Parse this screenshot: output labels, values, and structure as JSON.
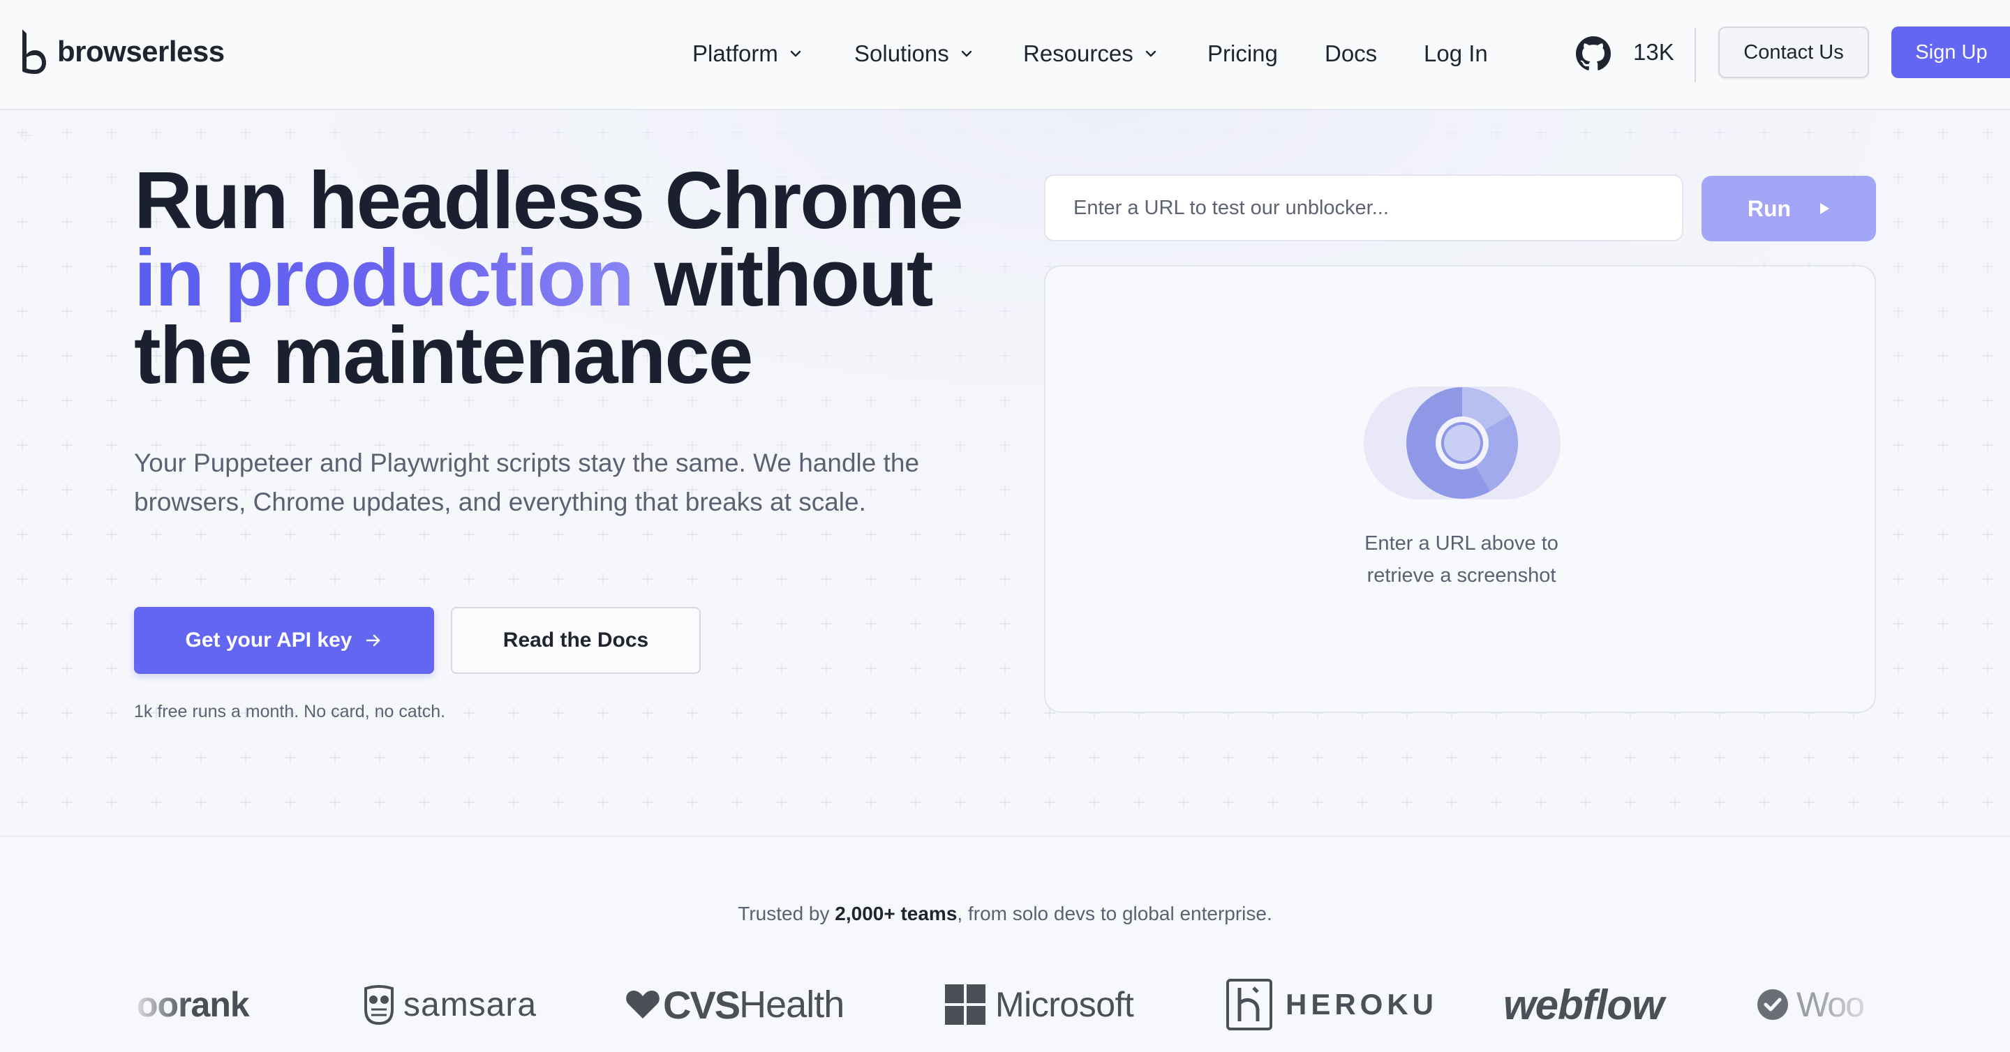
{
  "header": {
    "brand": "browserless",
    "nav": [
      {
        "label": "Platform",
        "has_dropdown": true
      },
      {
        "label": "Solutions",
        "has_dropdown": true
      },
      {
        "label": "Resources",
        "has_dropdown": true
      },
      {
        "label": "Pricing",
        "has_dropdown": false
      },
      {
        "label": "Docs",
        "has_dropdown": false
      },
      {
        "label": "Log In",
        "has_dropdown": false
      }
    ],
    "github_icon": "github-icon",
    "github_stars": "13K",
    "contact_label": "Contact Us",
    "signup_label": "Sign Up"
  },
  "hero": {
    "title_line1": "Run headless Chrome",
    "title_accent": "in production",
    "title_line2_rest": " without",
    "title_line3": "the maintenance",
    "subtitle": "Your Puppeteer and Playwright scripts stay the same. We handle the browsers, Chrome updates, and everything that breaks at scale.",
    "cta_primary": "Get your API key",
    "cta_secondary": "Read the Docs",
    "note": "1k free runs a month. No card, no catch."
  },
  "tester": {
    "url_placeholder": "Enter a URL to test our unblocker...",
    "url_value": "",
    "run_label": "Run",
    "empty_line1": "Enter a URL above to",
    "empty_line2": "retrieve a screenshot"
  },
  "trusted": {
    "prefix": "Trusted by ",
    "highlight": "2,000+ teams",
    "suffix": ", from solo devs to global enterprise."
  },
  "logos": [
    {
      "name": "woorank",
      "text": "oorank"
    },
    {
      "name": "samsara",
      "text": "samsara"
    },
    {
      "name": "cvs-health",
      "text_bold": "CVS",
      "text_light": "Health"
    },
    {
      "name": "microsoft",
      "text": "Microsoft"
    },
    {
      "name": "heroku",
      "text": "HEROKU"
    },
    {
      "name": "webflow",
      "text": "webflow"
    },
    {
      "name": "woo",
      "text": "Woo"
    }
  ],
  "colors": {
    "accent": "#6366f1",
    "accent_light": "#a3a6f7",
    "text_dark": "#1f2430",
    "text_muted": "#5b6172"
  }
}
